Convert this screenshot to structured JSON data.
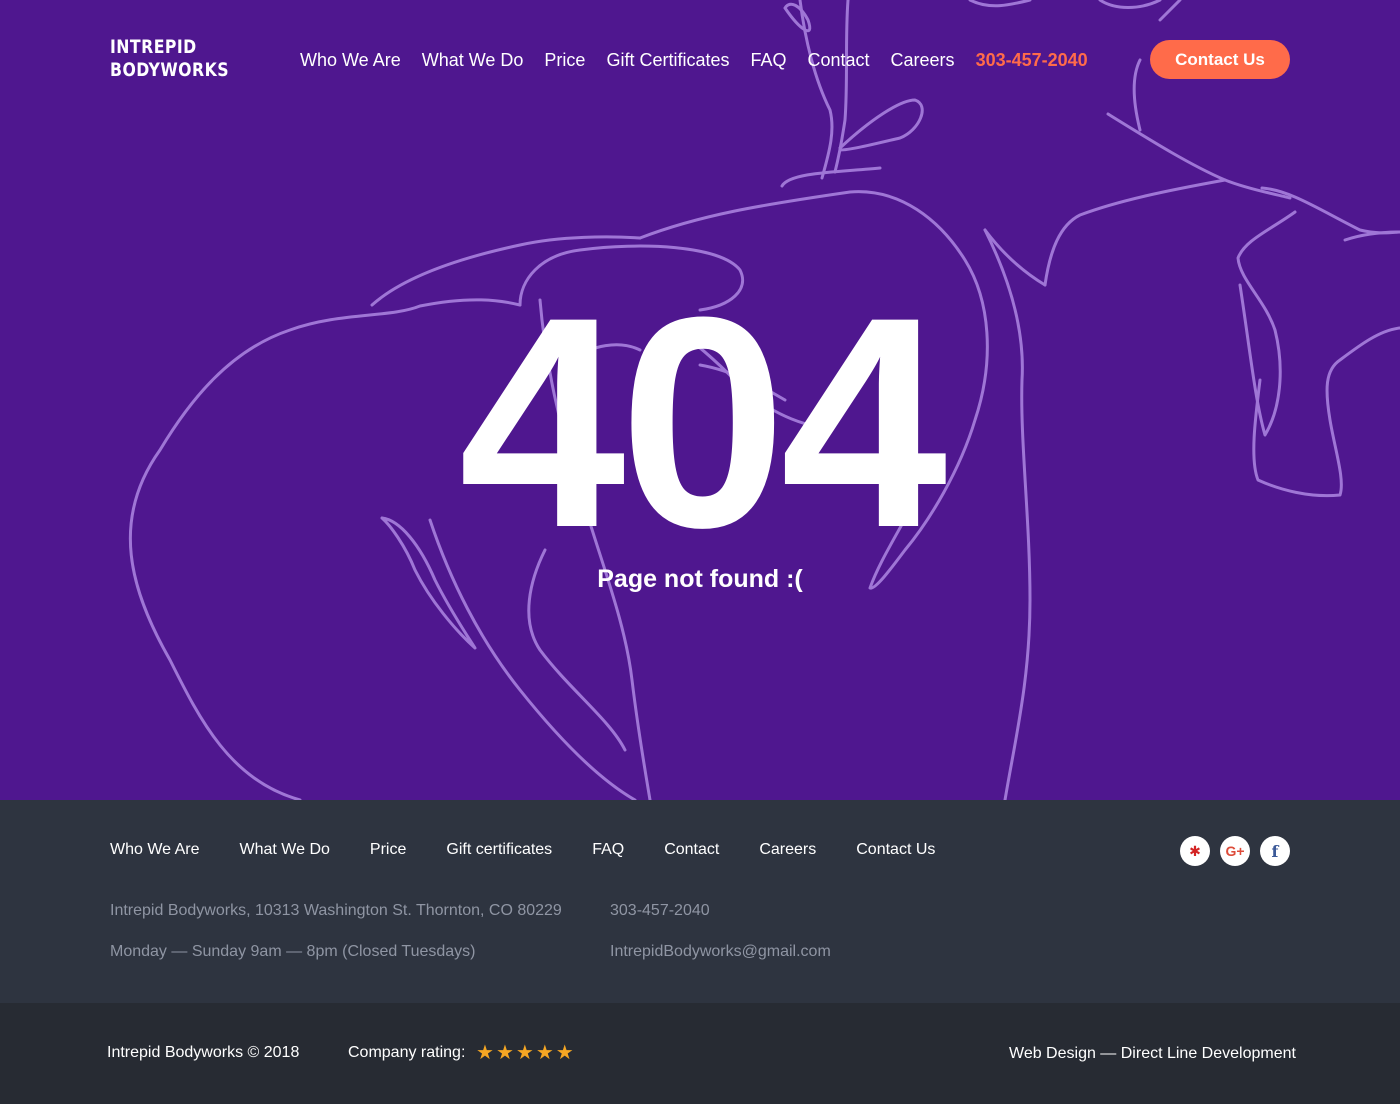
{
  "header": {
    "logo_line1": "Intrepid",
    "logo_line2": "Bodyworks",
    "nav": [
      "Who We Are",
      "What We Do",
      "Price",
      "Gift Certificates",
      "FAQ",
      "Contact",
      "Careers"
    ],
    "phone": "303-457-2040",
    "cta_label": "Contact Us"
  },
  "hero": {
    "code": "404",
    "message": "Page not found :("
  },
  "footer": {
    "nav": [
      "Who We Are",
      "What We Do",
      "Price",
      "Gift certificates",
      "FAQ",
      "Contact",
      "Careers",
      "Contact Us"
    ],
    "address": "Intrepid Bodyworks, 10313 Washington St. Thornton, CO 80229",
    "hours": "Monday — Sunday 9am — 8pm (Closed Tuesdays)",
    "phone": "303-457-2040",
    "email": "IntrepidBodyworks@gmail.com",
    "social": [
      {
        "icon": "yelp-icon",
        "glyph": "✱",
        "color": "#d32323"
      },
      {
        "icon": "google-plus-icon",
        "glyph": "G+",
        "color": "#dd4b39"
      },
      {
        "icon": "facebook-icon",
        "glyph": "f",
        "color": "#3b5998"
      }
    ]
  },
  "bottom": {
    "copyright": "Intrepid Bodyworks © 2018",
    "rating_label": "Company rating:",
    "rating": 5,
    "rating_max": 5,
    "credit": "Web Design — Direct Line Development"
  },
  "colors": {
    "hero_bg": "#4f178f",
    "accent": "#ff6b4a",
    "footer_bg": "#2e3440",
    "bottom_bg": "#272b33",
    "star": "#f5a623",
    "line_art": "#9f76d6"
  }
}
